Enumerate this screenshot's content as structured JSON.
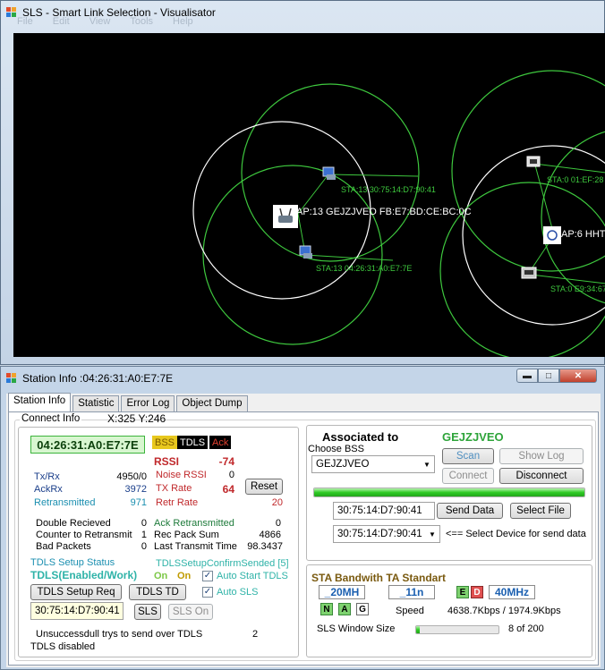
{
  "visualiser": {
    "title": "SLS - Smart Link Selection - Visualisator",
    "menu": [
      "File",
      "Edit",
      "View",
      "Tools",
      "Help"
    ],
    "nodes": [
      {
        "label": "AP:13 GEJZJVEO FB:E7:BD:CE:BC:0C",
        "kind": "ap"
      },
      {
        "label": "STA:13 30:75:14:D7:90:41",
        "kind": "sta"
      },
      {
        "label": "STA:13 04:26:31:A0:E7:7E",
        "kind": "sta"
      },
      {
        "label": "STA:0 01:EF:28",
        "kind": "sta"
      },
      {
        "label": "AP:6 HHT",
        "kind": "ap"
      },
      {
        "label": "STA:0 E9:34:67:C",
        "kind": "sta"
      }
    ]
  },
  "station": {
    "title": "Station Info :04:26:31:A0:E7:7E",
    "tabs": [
      "Station Info",
      "Statistic",
      "Error Log",
      "Object Dump"
    ],
    "connect_info": {
      "label": "Connect Info",
      "coords": "X:325 Y:246",
      "mac": "04:26:31:A0:E7:7E",
      "tags": {
        "bss": "BSS",
        "tdls": "TDLS",
        "ack": "Ack"
      },
      "txrx_label": "Tx/Rx",
      "txrx": "4950/0",
      "ackrx_label": "AckRx",
      "ackrx": "3972",
      "retrans_label": "Retransmitted",
      "retrans": "971",
      "rssi_label": "RSSI",
      "rssi": "-74",
      "noise_label": "Noise RSSI",
      "noise": "0",
      "txrate_label": "TX Rate",
      "txrate": "64",
      "reset": "Reset",
      "retr_label": "Retr Rate",
      "retr": "20",
      "dbl_label": "Double Recieved",
      "dbl": "0",
      "ctr_label": "Counter to Retransmit",
      "ctr": "1",
      "bad_label": "Bad Packets",
      "bad": "0",
      "ackret_label": "Ack Retransmitted",
      "ackret": "0",
      "recpack_label": "Rec Pack Sum",
      "recpack": "4866",
      "lastt_label": "Last Transmit Time",
      "lastt": "98.3437",
      "tdls_status_label": "TDLS Setup Status",
      "tdls_status": "TDLS(Enabled/Work)",
      "tdls_confirm": "TDLSSetupConfirmSended [5]",
      "on1": "On",
      "on2": "On",
      "auto_start": "Auto Start TDLS",
      "auto_sls": "Auto SLS",
      "tdls_setup_req": "TDLS Setup Req",
      "tdls_td": "TDLS TD",
      "peer_mac": "30:75:14:D7:90:41",
      "sls": "SLS",
      "sls_on": "SLS On",
      "unsucc_label": "Unsuccessdull trys to send over TDLS",
      "unsucc": "2",
      "tdls_disabled": "TDLS disabled"
    },
    "assoc": {
      "label": "Associated to",
      "ssid": "GEJZJVEO",
      "choose_bss": "Choose BSS",
      "bss_selected": "GEJZJVEO",
      "scan": "Scan",
      "show_log": "Show Log",
      "connect": "Connect",
      "disconnect": "Disconnect",
      "progress": 1.0,
      "send_mac": "30:75:14:D7:90:41",
      "send_data": "Send Data",
      "select_file": "Select File",
      "device_selected": "30:75:14:D7:90:41",
      "device_hint": "<== Select Device for send data"
    },
    "bandwidth": {
      "title": "STA Bandwith TA Standart",
      "bw": "_20MH",
      "std": "_11n",
      "e": "E",
      "d": "D",
      "mhz": "40MHz",
      "n": "N",
      "a": "A",
      "g": "G",
      "speed_label": "Speed",
      "speed": "4638.7Kbps / 1974.9Kbps",
      "sls_window_label": "SLS Window Size",
      "sls_window": "8 of 200",
      "sls_progress": 0.04
    }
  },
  "colors": {
    "canvas": "#000000",
    "ring_green": "#3ec83e",
    "ring_white": "#ffffff",
    "accent_red": "#c0282b",
    "accent_blue": "#1a3e8a",
    "link_cyan": "#1b8fb0",
    "tdls_green": "#2fb3a8"
  }
}
